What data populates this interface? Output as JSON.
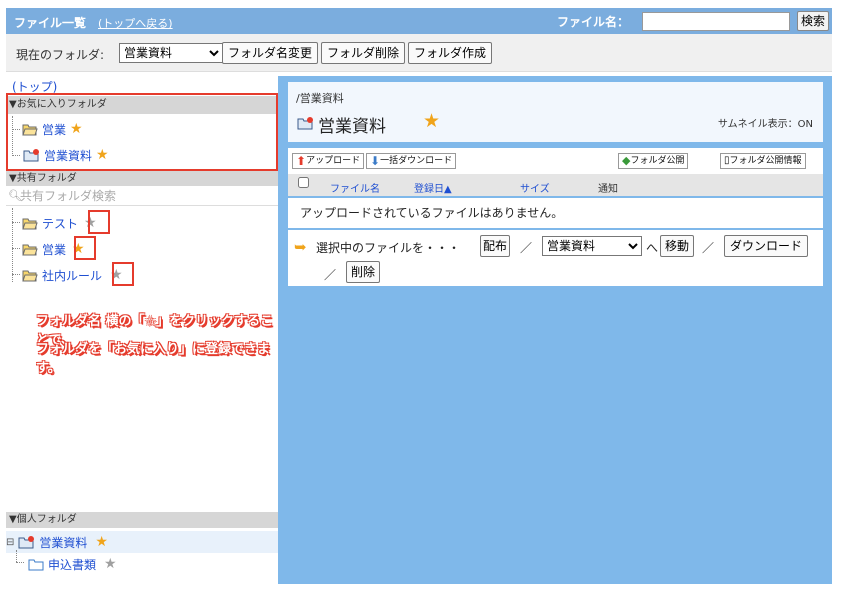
{
  "header": {
    "title": "ファイル一覧",
    "back_link": "(トップへ戻る)",
    "filename_label": "ファイル名：",
    "search_button": "検索"
  },
  "folderbar": {
    "current_label": "現在のフォルダ:",
    "selected_folder": "営業資料",
    "rename_button": "フォルダ名変更",
    "delete_button": "フォルダ削除",
    "create_button": "フォルダ作成"
  },
  "left": {
    "top_link": "(トップ)",
    "favorites_head": "▼お気に入りフォルダ",
    "favorites": [
      {
        "label": "営業",
        "star": "★"
      },
      {
        "label": "営業資料",
        "star": "★"
      }
    ],
    "shared_head": "▼共有フォルダ",
    "shared_search_placeholder": "共有フォルダ検索",
    "shared": [
      {
        "label": "テスト",
        "star": "★"
      },
      {
        "label": "営業",
        "star": "★"
      },
      {
        "label": "社内ルール",
        "star": "★"
      }
    ],
    "personal_head": "▼個人フォルダ",
    "personal": [
      {
        "label": "営業資料",
        "star": "★"
      },
      {
        "label": "申込書類",
        "star": "★"
      }
    ]
  },
  "right": {
    "path": "/営業資料",
    "folder_name": "営業資料",
    "folder_star": "★",
    "thumbnail_status": "サムネイル表示：ON",
    "toolbar": {
      "upload": "アップロード",
      "bulk_download": "一括ダウンロード",
      "publish": "フォルダ公開",
      "publish_info": "フォルダ公開情報"
    },
    "columns": {
      "name": "ファイル名",
      "date": "登録日▲",
      "size": "サイズ",
      "notify": "通知"
    },
    "empty_message": "アップロードされているファイルはありません。",
    "actions": {
      "selected_label": "選択中のファイルを・・・",
      "distribute": "配布",
      "sep1": "／",
      "target_folder": "営業資料",
      "to": "へ",
      "move": "移動",
      "sep2": "／",
      "download": "ダウンロード",
      "sep3": "／",
      "delete": "削除"
    }
  },
  "annotation": {
    "line1": "フォルダ名 横の「☆」をクリックすることで、",
    "line2": "フォルダを「お気に入り」に登録できます。"
  },
  "colors": {
    "header": "#7badde",
    "right_panel": "#7fb8ea",
    "highlight": "#e53b2c",
    "fav_star": "#f0a41b",
    "inactive_star": "#a0a0a0"
  }
}
